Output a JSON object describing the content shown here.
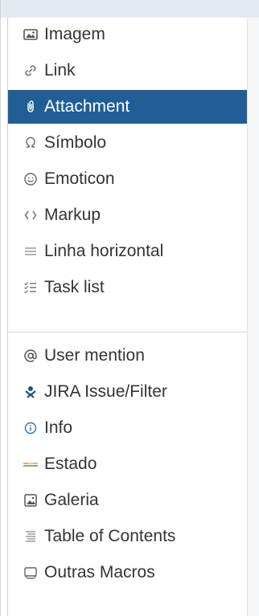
{
  "menu": {
    "items": [
      {
        "label": "Imagem",
        "icon": "image-icon"
      },
      {
        "label": "Link",
        "icon": "link-icon"
      },
      {
        "label": "Attachment",
        "icon": "paperclip-icon",
        "active": true
      },
      {
        "label": "Símbolo",
        "icon": "omega-icon"
      },
      {
        "label": "Emoticon",
        "icon": "smiley-icon"
      },
      {
        "label": "Markup",
        "icon": "braces-icon"
      },
      {
        "label": "Linha horizontal",
        "icon": "horizontal-rule-icon"
      },
      {
        "label": "Task list",
        "icon": "task-list-icon"
      }
    ],
    "macros": [
      {
        "label": "User mention",
        "icon": "at-icon"
      },
      {
        "label": "JIRA Issue/Filter",
        "icon": "jira-icon"
      },
      {
        "label": "Info",
        "icon": "info-icon"
      },
      {
        "label": "Estado",
        "icon": "status-icon"
      },
      {
        "label": "Galeria",
        "icon": "gallery-icon"
      },
      {
        "label": "Table of Contents",
        "icon": "toc-icon"
      },
      {
        "label": "Outras Macros",
        "icon": "macros-icon"
      }
    ]
  },
  "colors": {
    "active_bg": "#215e96",
    "text": "#333333",
    "icon_gray": "#7a7a7a"
  }
}
